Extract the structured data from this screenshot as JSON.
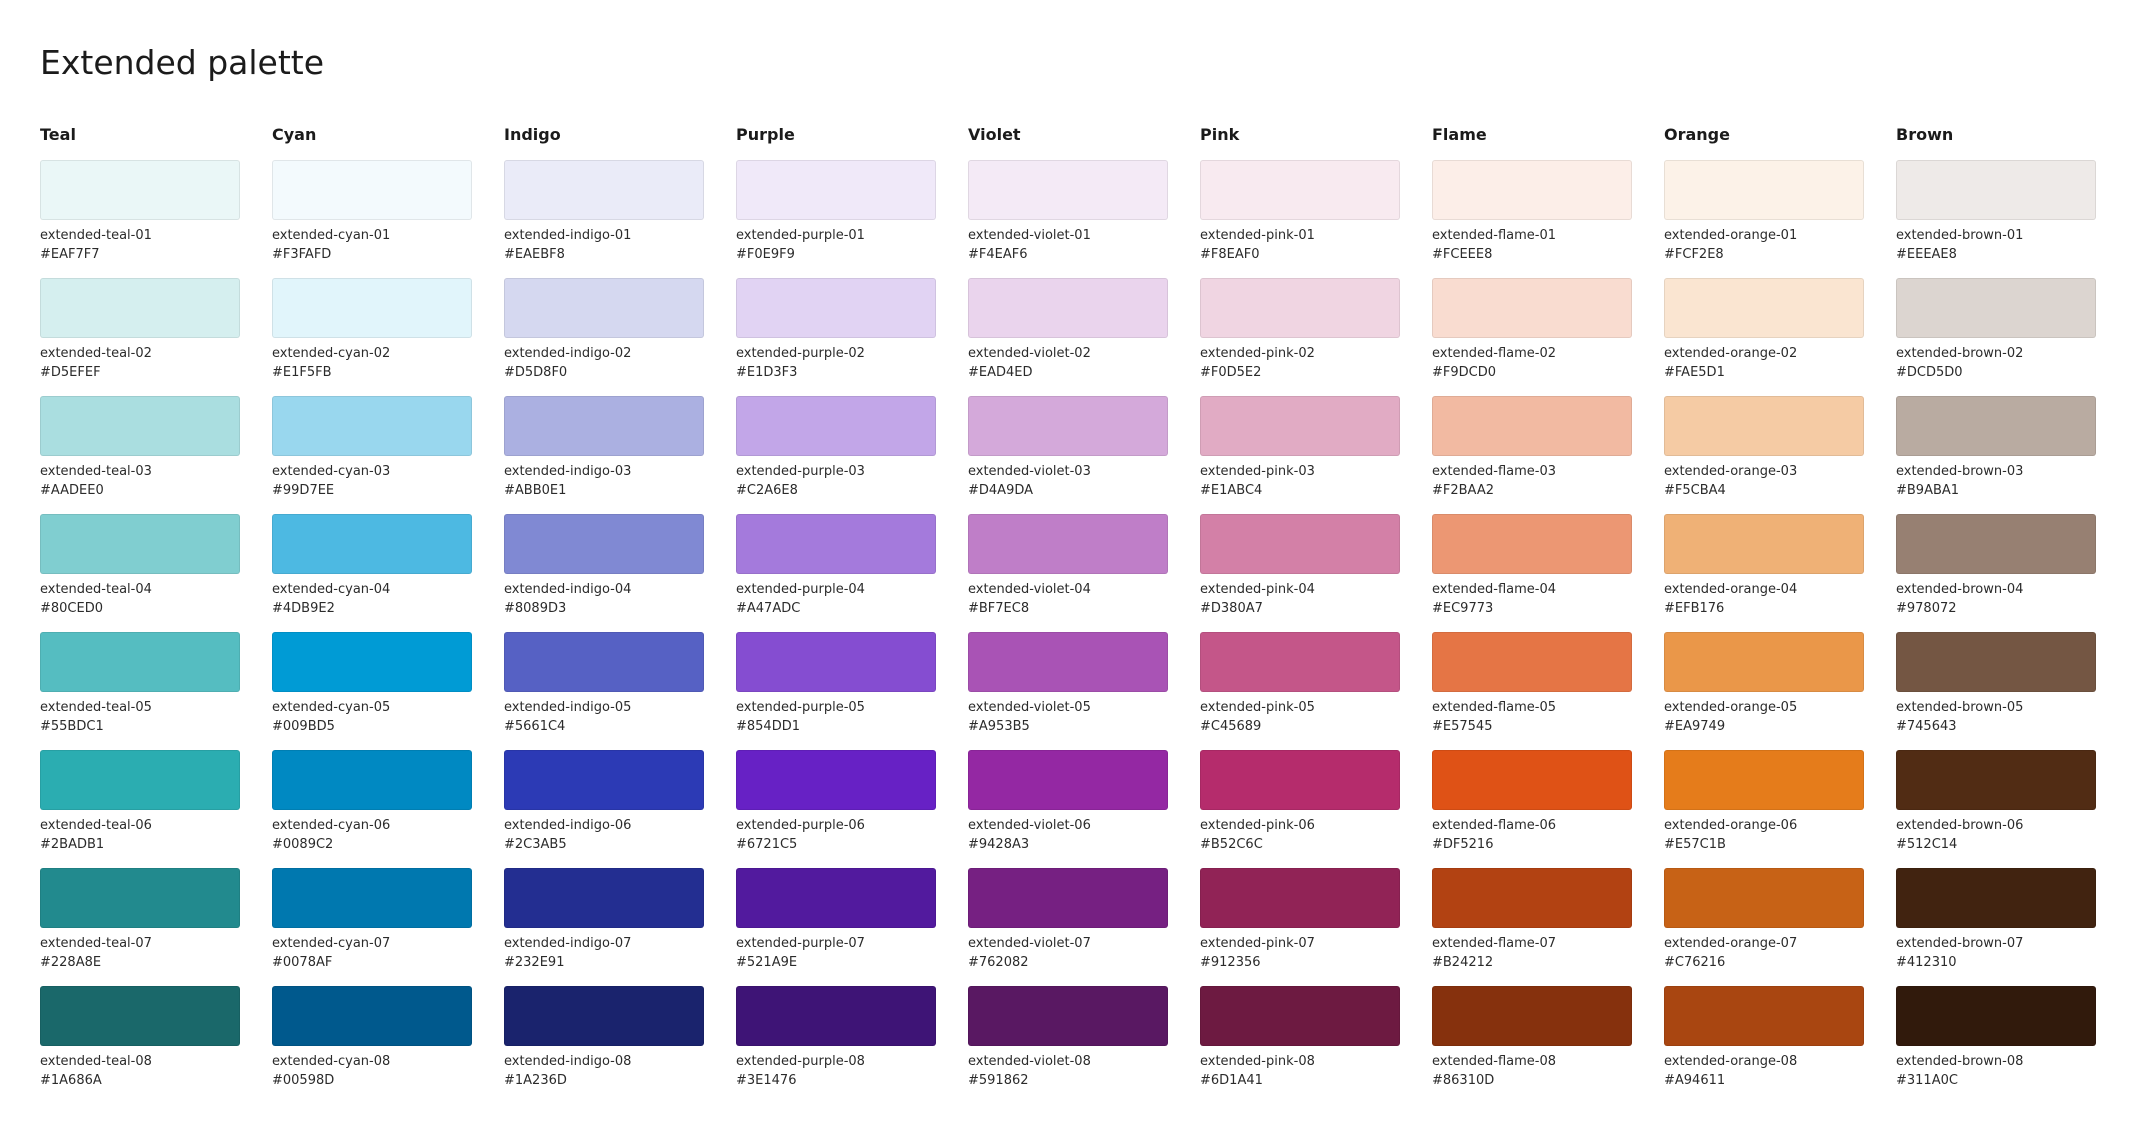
{
  "page": {
    "title": "Extended palette"
  },
  "palette": {
    "families": [
      {
        "name": "Teal",
        "swatches": [
          {
            "name": "extended-teal-01",
            "hex": "#EAF7F7"
          },
          {
            "name": "extended-teal-02",
            "hex": "#D5EFEF"
          },
          {
            "name": "extended-teal-03",
            "hex": "#AADEE0"
          },
          {
            "name": "extended-teal-04",
            "hex": "#80CED0"
          },
          {
            "name": "extended-teal-05",
            "hex": "#55BDC1"
          },
          {
            "name": "extended-teal-06",
            "hex": "#2BADB1"
          },
          {
            "name": "extended-teal-07",
            "hex": "#228A8E"
          },
          {
            "name": "extended-teal-08",
            "hex": "#1A686A"
          }
        ]
      },
      {
        "name": "Cyan",
        "swatches": [
          {
            "name": "extended-cyan-01",
            "hex": "#F3FAFD"
          },
          {
            "name": "extended-cyan-02",
            "hex": "#E1F5FB"
          },
          {
            "name": "extended-cyan-03",
            "hex": "#99D7EE"
          },
          {
            "name": "extended-cyan-04",
            "hex": "#4DB9E2"
          },
          {
            "name": "extended-cyan-05",
            "hex": "#009BD5"
          },
          {
            "name": "extended-cyan-06",
            "hex": "#0089C2"
          },
          {
            "name": "extended-cyan-07",
            "hex": "#0078AF"
          },
          {
            "name": "extended-cyan-08",
            "hex": "#00598D"
          }
        ]
      },
      {
        "name": "Indigo",
        "swatches": [
          {
            "name": "extended-indigo-01",
            "hex": "#EAEBF8"
          },
          {
            "name": "extended-indigo-02",
            "hex": "#D5D8F0"
          },
          {
            "name": "extended-indigo-03",
            "hex": "#ABB0E1"
          },
          {
            "name": "extended-indigo-04",
            "hex": "#8089D3"
          },
          {
            "name": "extended-indigo-05",
            "hex": "#5661C4"
          },
          {
            "name": "extended-indigo-06",
            "hex": "#2C3AB5"
          },
          {
            "name": "extended-indigo-07",
            "hex": "#232E91"
          },
          {
            "name": "extended-indigo-08",
            "hex": "#1A236D"
          }
        ]
      },
      {
        "name": "Purple",
        "swatches": [
          {
            "name": "extended-purple-01",
            "hex": "#F0E9F9"
          },
          {
            "name": "extended-purple-02",
            "hex": "#E1D3F3"
          },
          {
            "name": "extended-purple-03",
            "hex": "#C2A6E8"
          },
          {
            "name": "extended-purple-04",
            "hex": "#A47ADC"
          },
          {
            "name": "extended-purple-05",
            "hex": "#854DD1"
          },
          {
            "name": "extended-purple-06",
            "hex": "#6721C5"
          },
          {
            "name": "extended-purple-07",
            "hex": "#521A9E"
          },
          {
            "name": "extended-purple-08",
            "hex": "#3E1476"
          }
        ]
      },
      {
        "name": "Violet",
        "swatches": [
          {
            "name": "extended-violet-01",
            "hex": "#F4EAF6"
          },
          {
            "name": "extended-violet-02",
            "hex": "#EAD4ED"
          },
          {
            "name": "extended-violet-03",
            "hex": "#D4A9DA"
          },
          {
            "name": "extended-violet-04",
            "hex": "#BF7EC8"
          },
          {
            "name": "extended-violet-05",
            "hex": "#A953B5"
          },
          {
            "name": "extended-violet-06",
            "hex": "#9428A3"
          },
          {
            "name": "extended-violet-07",
            "hex": "#762082"
          },
          {
            "name": "extended-violet-08",
            "hex": "#591862"
          }
        ]
      },
      {
        "name": "Pink",
        "swatches": [
          {
            "name": "extended-pink-01",
            "hex": "#F8EAF0"
          },
          {
            "name": "extended-pink-02",
            "hex": "#F0D5E2"
          },
          {
            "name": "extended-pink-03",
            "hex": "#E1ABC4"
          },
          {
            "name": "extended-pink-04",
            "hex": "#D380A7"
          },
          {
            "name": "extended-pink-05",
            "hex": "#C45689"
          },
          {
            "name": "extended-pink-06",
            "hex": "#B52C6C"
          },
          {
            "name": "extended-pink-07",
            "hex": "#912356"
          },
          {
            "name": "extended-pink-08",
            "hex": "#6D1A41"
          }
        ]
      },
      {
        "name": "Flame",
        "swatches": [
          {
            "name": "extended-flame-01",
            "hex": "#FCEEE8"
          },
          {
            "name": "extended-flame-02",
            "hex": "#F9DCD0"
          },
          {
            "name": "extended-flame-03",
            "hex": "#F2BAA2"
          },
          {
            "name": "extended-flame-04",
            "hex": "#EC9773"
          },
          {
            "name": "extended-flame-05",
            "hex": "#E57545"
          },
          {
            "name": "extended-flame-06",
            "hex": "#DF5216"
          },
          {
            "name": "extended-flame-07",
            "hex": "#B24212"
          },
          {
            "name": "extended-flame-08",
            "hex": "#86310D"
          }
        ]
      },
      {
        "name": "Orange",
        "swatches": [
          {
            "name": "extended-orange-01",
            "hex": "#FCF2E8"
          },
          {
            "name": "extended-orange-02",
            "hex": "#FAE5D1"
          },
          {
            "name": "extended-orange-03",
            "hex": "#F5CBA4"
          },
          {
            "name": "extended-orange-04",
            "hex": "#EFB176"
          },
          {
            "name": "extended-orange-05",
            "hex": "#EA9749"
          },
          {
            "name": "extended-orange-06",
            "hex": "#E57C1B"
          },
          {
            "name": "extended-orange-07",
            "hex": "#C76216"
          },
          {
            "name": "extended-orange-08",
            "hex": "#A94611"
          }
        ]
      },
      {
        "name": "Brown",
        "swatches": [
          {
            "name": "extended-brown-01",
            "hex": "#EEEAE8"
          },
          {
            "name": "extended-brown-02",
            "hex": "#DCD5D0"
          },
          {
            "name": "extended-brown-03",
            "hex": "#B9ABA1"
          },
          {
            "name": "extended-brown-04",
            "hex": "#978072"
          },
          {
            "name": "extended-brown-05",
            "hex": "#745643"
          },
          {
            "name": "extended-brown-06",
            "hex": "#512C14"
          },
          {
            "name": "extended-brown-07",
            "hex": "#412310"
          },
          {
            "name": "extended-brown-08",
            "hex": "#311A0C"
          }
        ]
      }
    ]
  }
}
